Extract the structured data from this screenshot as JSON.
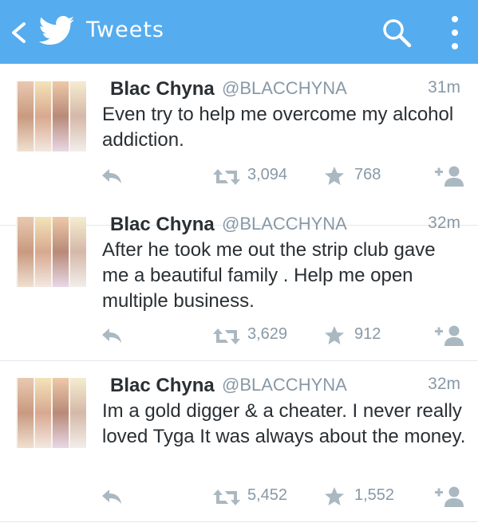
{
  "header": {
    "title": "Tweets",
    "accent_color": "#55acee",
    "icons": [
      "back-icon",
      "twitter-bird-icon",
      "search-icon",
      "more-vertical-icon"
    ]
  },
  "tweets": [
    {
      "name": "Blac Chyna",
      "handle": "@BLACCHYNA",
      "time": "31m",
      "text": "Even try to help me overcome my alcohol addiction.",
      "retweets": "3,094",
      "favorites": "768"
    },
    {
      "name": "Blac Chyna",
      "handle": "@BLACCHYNA",
      "time": "32m",
      "text": "After he took me out the strip club gave me a beautiful family . Help me open multiple business.",
      "retweets": "3,629",
      "favorites": "912"
    },
    {
      "name": "Blac Chyna",
      "handle": "@BLACCHYNA",
      "time": "32m",
      "text": "Im a gold digger & a cheater. I never really loved Tyga  It was always about the money.",
      "retweets": "5,452",
      "favorites": "1,552"
    }
  ]
}
